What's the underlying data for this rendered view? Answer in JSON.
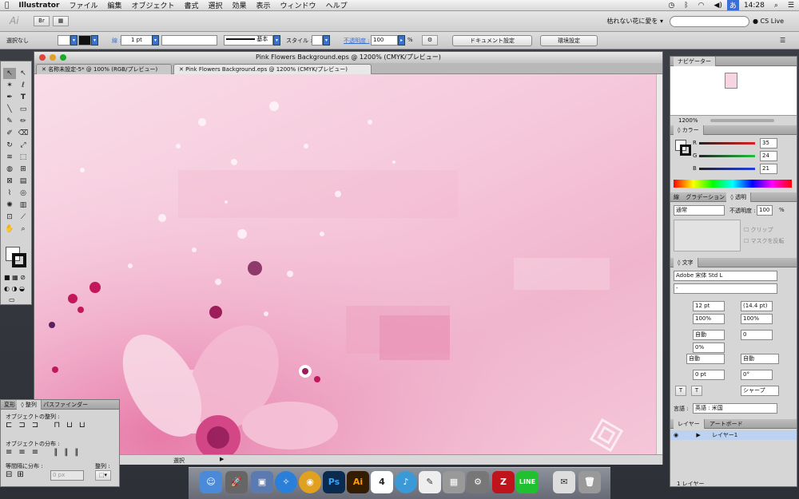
{
  "menubar": {
    "app": "Illustrator",
    "items": [
      "ファイル",
      "編集",
      "オブジェクト",
      "書式",
      "選択",
      "効果",
      "表示",
      "ウィンドウ",
      "ヘルプ"
    ],
    "clock": "14:28",
    "ime": "あ"
  },
  "apptoolbar": {
    "logo": "Ai",
    "bridge": "Br",
    "search_field": "枯れない花に愛を",
    "cslive": "CS Live"
  },
  "control": {
    "selection": "選択なし",
    "stroke_label": "線 :",
    "stroke_weight": "1 pt",
    "line_style": "基本",
    "style_label": "スタイル :",
    "opacity_label": "不透明度 :",
    "opacity": "100",
    "opacity_unit": "%",
    "doc_settings": "ドキュメント設定",
    "preferences": "環境設定"
  },
  "document": {
    "title": "Pink Flowers Background.eps @ 1200% (CMYK/プレビュー)",
    "tabs": [
      "名称未設定-5* @ 100% (RGB/プレビュー)",
      "Pink Flowers Background.eps @ 1200% (CMYK/プレビュー)"
    ],
    "status_tool": "選択"
  },
  "navigator": {
    "title": "ナビゲーター",
    "zoom": "1200%"
  },
  "color": {
    "title": "カラー",
    "r_label": "R",
    "g_label": "G",
    "b_label": "B",
    "r": "35",
    "g": "24",
    "b": "21"
  },
  "transparency": {
    "tabs": [
      "線",
      "グラデーション",
      "透明"
    ],
    "blend": "通常",
    "opacity_label": "不透明度 :",
    "opacity": "100",
    "unit": "%",
    "clip": "クリップ",
    "invert": "マスクを反転"
  },
  "character": {
    "title": "文字",
    "font": "Adobe 宋体 Std L",
    "style": "-",
    "size": "12 pt",
    "leading": "(14.4 pt)",
    "hscale": "100%",
    "vscale": "100%",
    "tracking_auto": "自動",
    "kerning": "0",
    "tsume": "0%",
    "aki_left": "自動",
    "aki_right": "自動",
    "baseline": "0 pt",
    "rotation": "0°",
    "aa": "シャープ",
    "lang_label": "言語 :",
    "lang": "英語 : 米国"
  },
  "layers": {
    "tabs": [
      "レイヤー",
      "アートボード"
    ],
    "layer_name": "レイヤー1",
    "count": "1 レイヤー"
  },
  "align": {
    "tabs": [
      "変形",
      "整列",
      "パスファインダー"
    ],
    "objects_align": "オブジェクトの整列 :",
    "objects_dist": "オブジェクトの分布 :",
    "spacing": "等間隔に分布 :",
    "align_to": "整列 :",
    "px": "0 px"
  },
  "dock": {
    "apps": [
      "Finder",
      "Launchpad",
      "Preview",
      "Safari",
      "Chrome",
      "Ps",
      "Ai",
      "Calendar",
      "iTunes",
      "TextEdit",
      "Calculator",
      "System Preferences",
      "FileZilla",
      "LINE",
      "Mail",
      "Trash"
    ],
    "calendar_day": "4"
  },
  "colors": {
    "accent": "#3a6fd8",
    "canvas_pink": "#f4c6d8",
    "magenta": "#c2185b"
  }
}
